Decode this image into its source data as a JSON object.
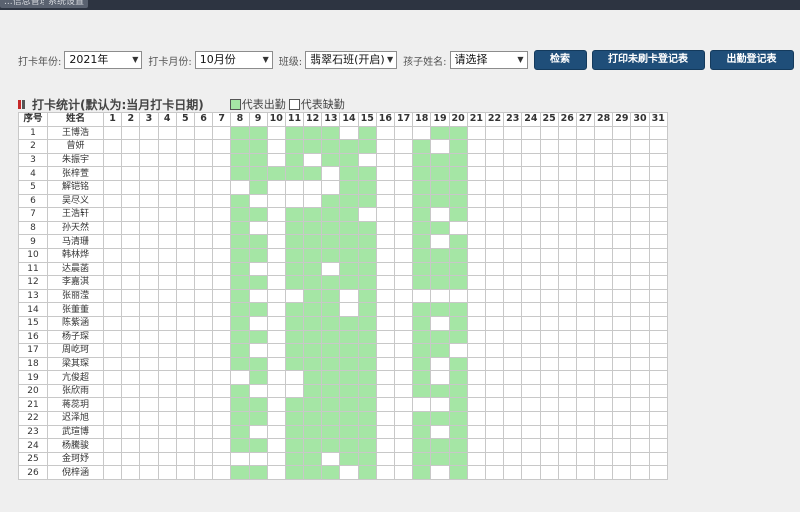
{
  "topbar": {
    "buttons": [
      "...信息管理",
      "系统设置"
    ]
  },
  "filters": {
    "year_label": "打卡年份:",
    "year_value": "2021年",
    "month_label": "打卡月份:",
    "month_value": "10月份",
    "class_label": "班级:",
    "class_value": "翡翠石班(开启)",
    "child_label": "孩子姓名:",
    "child_value": "请选择"
  },
  "buttons": {
    "search": "检索",
    "print_missing": "打印未刷卡登记表",
    "attendance": "出勤登记表"
  },
  "section": {
    "title": "打卡统计(默认为:当月打卡日期)",
    "legend_present": "代表出勤",
    "legend_absent": "代表缺勤"
  },
  "colors": {
    "present": "#a5e6a5",
    "absent": "#ffffff",
    "accent": "#1f4e79"
  },
  "table": {
    "col_index": "序号",
    "col_name": "姓名",
    "days": [
      "1",
      "2",
      "3",
      "4",
      "5",
      "6",
      "7",
      "8",
      "9",
      "10",
      "11",
      "12",
      "13",
      "14",
      "15",
      "16",
      "17",
      "18",
      "19",
      "20",
      "21",
      "22",
      "23",
      "24",
      "25",
      "26",
      "27",
      "28",
      "29",
      "30",
      "31"
    ],
    "rows": [
      {
        "no": "1",
        "name": "王博浩",
        "present": [
          8,
          9,
          11,
          12,
          13,
          15,
          19,
          20
        ]
      },
      {
        "no": "2",
        "name": "曾妍",
        "present": [
          8,
          9,
          11,
          12,
          13,
          14,
          15,
          18,
          20
        ]
      },
      {
        "no": "3",
        "name": "朱振宇",
        "present": [
          8,
          9,
          11,
          13,
          14,
          18,
          19,
          20
        ]
      },
      {
        "no": "4",
        "name": "张梓萱",
        "present": [
          8,
          9,
          10,
          11,
          12,
          14,
          15,
          18,
          19,
          20
        ]
      },
      {
        "no": "5",
        "name": "解铠铭",
        "present": [
          9,
          14,
          15,
          18,
          19,
          20
        ]
      },
      {
        "no": "6",
        "name": "吴尽义",
        "present": [
          8,
          13,
          14,
          15,
          18,
          19,
          20
        ]
      },
      {
        "no": "7",
        "name": "王浩轩",
        "present": [
          8,
          9,
          11,
          12,
          13,
          14,
          18,
          20
        ]
      },
      {
        "no": "8",
        "name": "孙天然",
        "present": [
          8,
          11,
          12,
          13,
          14,
          15,
          18,
          19
        ]
      },
      {
        "no": "9",
        "name": "马清珊",
        "present": [
          8,
          9,
          11,
          12,
          13,
          14,
          15,
          18,
          20
        ]
      },
      {
        "no": "10",
        "name": "韩林烨",
        "present": [
          8,
          9,
          11,
          12,
          13,
          14,
          15,
          18,
          19,
          20
        ]
      },
      {
        "no": "11",
        "name": "达晨菡",
        "present": [
          8,
          11,
          12,
          14,
          15,
          18,
          19,
          20
        ]
      },
      {
        "no": "12",
        "name": "李嘉淇",
        "present": [
          8,
          9,
          11,
          12,
          13,
          14,
          15,
          18,
          19,
          20
        ]
      },
      {
        "no": "13",
        "name": "张丽滢",
        "present": [
          8,
          12,
          13,
          15
        ]
      },
      {
        "no": "14",
        "name": "张董董",
        "present": [
          8,
          9,
          11,
          12,
          13,
          15,
          18,
          19,
          20
        ]
      },
      {
        "no": "15",
        "name": "陈紫涵",
        "present": [
          8,
          11,
          12,
          13,
          14,
          15,
          18,
          20
        ]
      },
      {
        "no": "16",
        "name": "杨子琛",
        "present": [
          8,
          9,
          11,
          12,
          13,
          14,
          15,
          18,
          19,
          20
        ]
      },
      {
        "no": "17",
        "name": "周屹珂",
        "present": [
          8,
          11,
          12,
          13,
          14,
          15,
          18,
          19
        ]
      },
      {
        "no": "18",
        "name": "梁其琛",
        "present": [
          8,
          9,
          11,
          12,
          13,
          14,
          15,
          18,
          20
        ]
      },
      {
        "no": "19",
        "name": "亢俊超",
        "present": [
          9,
          12,
          13,
          14,
          15,
          18,
          20
        ]
      },
      {
        "no": "20",
        "name": "张欣雨",
        "present": [
          8,
          12,
          13,
          14,
          15,
          18,
          19,
          20
        ]
      },
      {
        "no": "21",
        "name": "蒋蕊玥",
        "present": [
          8,
          9,
          11,
          12,
          13,
          14,
          15,
          20
        ]
      },
      {
        "no": "22",
        "name": "迟泽旭",
        "present": [
          8,
          9,
          11,
          12,
          13,
          14,
          15,
          18,
          19,
          20
        ]
      },
      {
        "no": "23",
        "name": "武瑄博",
        "present": [
          8,
          11,
          12,
          13,
          14,
          15,
          18,
          20
        ]
      },
      {
        "no": "24",
        "name": "杨騰骏",
        "present": [
          8,
          9,
          11,
          12,
          13,
          14,
          15,
          18,
          19,
          20
        ]
      },
      {
        "no": "25",
        "name": "金珂妤",
        "present": [
          11,
          12,
          14,
          15,
          18,
          19,
          20
        ]
      },
      {
        "no": "26",
        "name": "倪梓涵",
        "present": [
          8,
          9,
          11,
          12,
          13,
          15,
          18,
          20
        ]
      }
    ]
  }
}
